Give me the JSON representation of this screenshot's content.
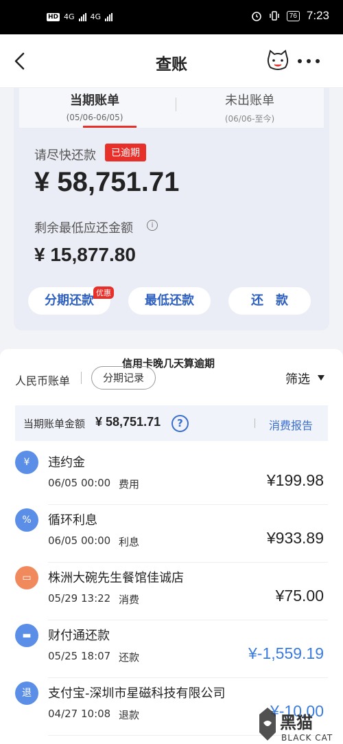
{
  "status": {
    "left_badges": [
      "HD",
      "4G",
      "4G"
    ],
    "battery": "76",
    "time": "7:23"
  },
  "nav": {
    "title": "查账",
    "icons": [
      "back-arrow-icon",
      "cat-mascot-icon",
      "more-icon"
    ]
  },
  "tabs": [
    {
      "label": "当期账单",
      "period": "(05/06-06/05)",
      "active": true
    },
    {
      "label": "未出账单",
      "period": "(06/06-至今)",
      "active": false
    }
  ],
  "bill": {
    "hurry_text": "请尽快还款",
    "overdue_badge": "已逾期",
    "total_amount": "¥ 58,751.71",
    "min_label": "剩余最低应还金额",
    "min_info_icon": "i",
    "min_amount": "¥ 15,877.80"
  },
  "actions": [
    {
      "label": "分期还款",
      "badge": "优惠"
    },
    {
      "label": "最低还款"
    },
    {
      "label": "还　款"
    }
  ],
  "watermark": "信用卡晚几天算逾期",
  "filters": {
    "currency": "人民币账单",
    "installment_record": "分期记录",
    "filter_label": "筛选"
  },
  "summary": {
    "label": "当期账单金额",
    "amount": "¥ 58,751.71",
    "help_icon": "?",
    "report": "消费报告"
  },
  "transactions": [
    {
      "icon": "¥",
      "icon_name": "yen-fee-icon",
      "color": "#5b8ee6",
      "name": "违约金",
      "time": "06/05 00:00",
      "type": "费用",
      "amount": "¥199.98"
    },
    {
      "icon": "%",
      "icon_name": "percent-interest-icon",
      "color": "#5b8ee6",
      "name": "循环利息",
      "time": "06/05 00:00",
      "type": "利息",
      "amount": "¥933.89"
    },
    {
      "icon": "▭",
      "icon_name": "shop-icon",
      "color": "#f08a5d",
      "name": "株洲大碗先生餐馆佳诚店",
      "time": "05/29 13:22",
      "type": "消费",
      "amount": "¥75.00"
    },
    {
      "icon": "▬",
      "icon_name": "wallet-icon",
      "color": "#5b8ee6",
      "name": "财付通还款",
      "time": "05/25 18:07",
      "type": "还款",
      "amount": "¥-1,559.19"
    },
    {
      "icon": "退",
      "icon_name": "refund-icon",
      "color": "#5b8ee6",
      "name": "支付宝-深圳市星磁科技有限公司",
      "time": "04/27 10:08",
      "type": "退款",
      "amount": "¥-10.00"
    }
  ],
  "corner_logo": {
    "cn": "黑猫",
    "en": "BLACK CAT"
  }
}
